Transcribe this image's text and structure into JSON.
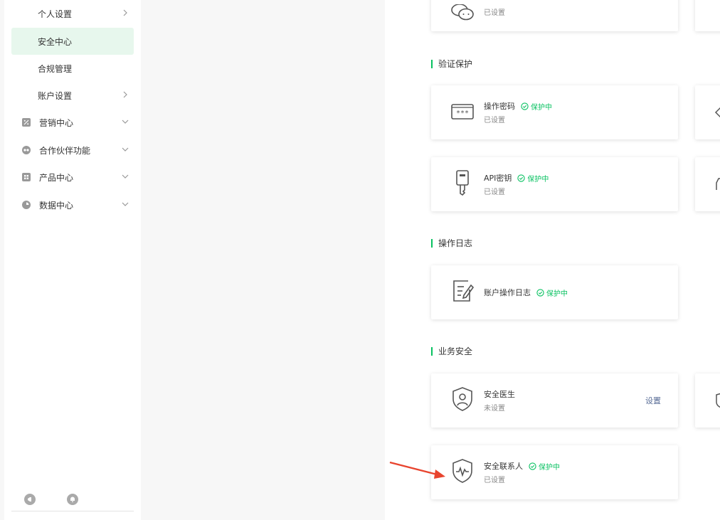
{
  "sidebar": {
    "items": [
      {
        "label": "个人设置",
        "type": "sub",
        "chevron": "right"
      },
      {
        "label": "安全中心",
        "type": "sub",
        "active": true
      },
      {
        "label": "合规管理",
        "type": "sub"
      },
      {
        "label": "账户设置",
        "type": "sub",
        "chevron": "right"
      },
      {
        "label": "营销中心",
        "type": "group",
        "icon": "percent-icon",
        "chevron": "down"
      },
      {
        "label": "合作伙伴功能",
        "type": "group",
        "icon": "partner-icon",
        "chevron": "down"
      },
      {
        "label": "产品中心",
        "type": "group",
        "icon": "grid-icon",
        "chevron": "down"
      },
      {
        "label": "数据中心",
        "type": "group",
        "icon": "pie-chart-icon",
        "chevron": "down"
      }
    ],
    "bottom_icons": [
      "megaphone-icon",
      "bell-icon"
    ]
  },
  "main": {
    "top_card": {
      "sub": "已设置"
    },
    "sections": [
      {
        "title": "验证保护"
      },
      {
        "title": "操作日志"
      },
      {
        "title": "业务安全"
      }
    ],
    "cards": {
      "operation_password": {
        "title": "操作密码",
        "badge": "保护中",
        "sub": "已设置",
        "icon": "password-icon"
      },
      "api_key": {
        "title": "API密钥",
        "badge": "保护中",
        "sub": "已设置",
        "icon": "key-icon"
      },
      "operation_log": {
        "title": "账户操作日志",
        "badge": "保护中",
        "icon": "log-edit-icon"
      },
      "security_doctor": {
        "title": "安全医生",
        "sub": "未设置",
        "action": "设置",
        "icon": "shield-user-icon"
      },
      "security_contact": {
        "title": "安全联系人",
        "badge": "保护中",
        "sub": "已设置",
        "icon": "shield-pulse-icon"
      }
    }
  },
  "colors": {
    "accent": "#07c160",
    "link": "#576b95",
    "active_bg": "#e7f7ed",
    "arrow": "#e8442e"
  }
}
